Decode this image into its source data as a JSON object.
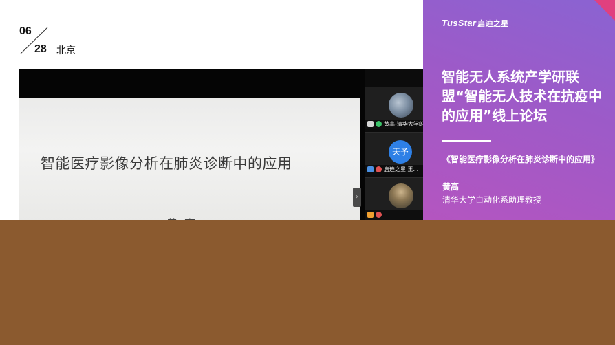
{
  "date": {
    "month": "06",
    "day": "28",
    "city": "北京"
  },
  "meeting": {
    "slide_title": "智能医疗影像分析在肺炎诊断中的应用",
    "slide_author": "黄高",
    "collapse_glyph": "›",
    "participants": [
      {
        "name": "黄高-清华大学的...",
        "avatar": "photo"
      },
      {
        "name": "启迪之星 王...",
        "avatar_text": "天予"
      },
      {
        "name": "",
        "avatar": "photo"
      }
    ]
  },
  "panel": {
    "logo": "TusStar",
    "logo_cn": "启迪之星",
    "headline": "智能无人系统产学研联盟“智能无人技术在抗疫中的应用”线上论坛",
    "talk_title": "《智能医疗影像分析在肺炎诊断中的应用》",
    "speaker": "黄高",
    "affiliation": "清华大学自动化系助理教授"
  },
  "colors": {
    "panel_gradient_start": "#8a63d2",
    "panel_gradient_end": "#b455c0",
    "corner_accent": "#e0407f",
    "bottom_block": "#8b5a2f",
    "avatar_blue": "#2e80e6"
  }
}
